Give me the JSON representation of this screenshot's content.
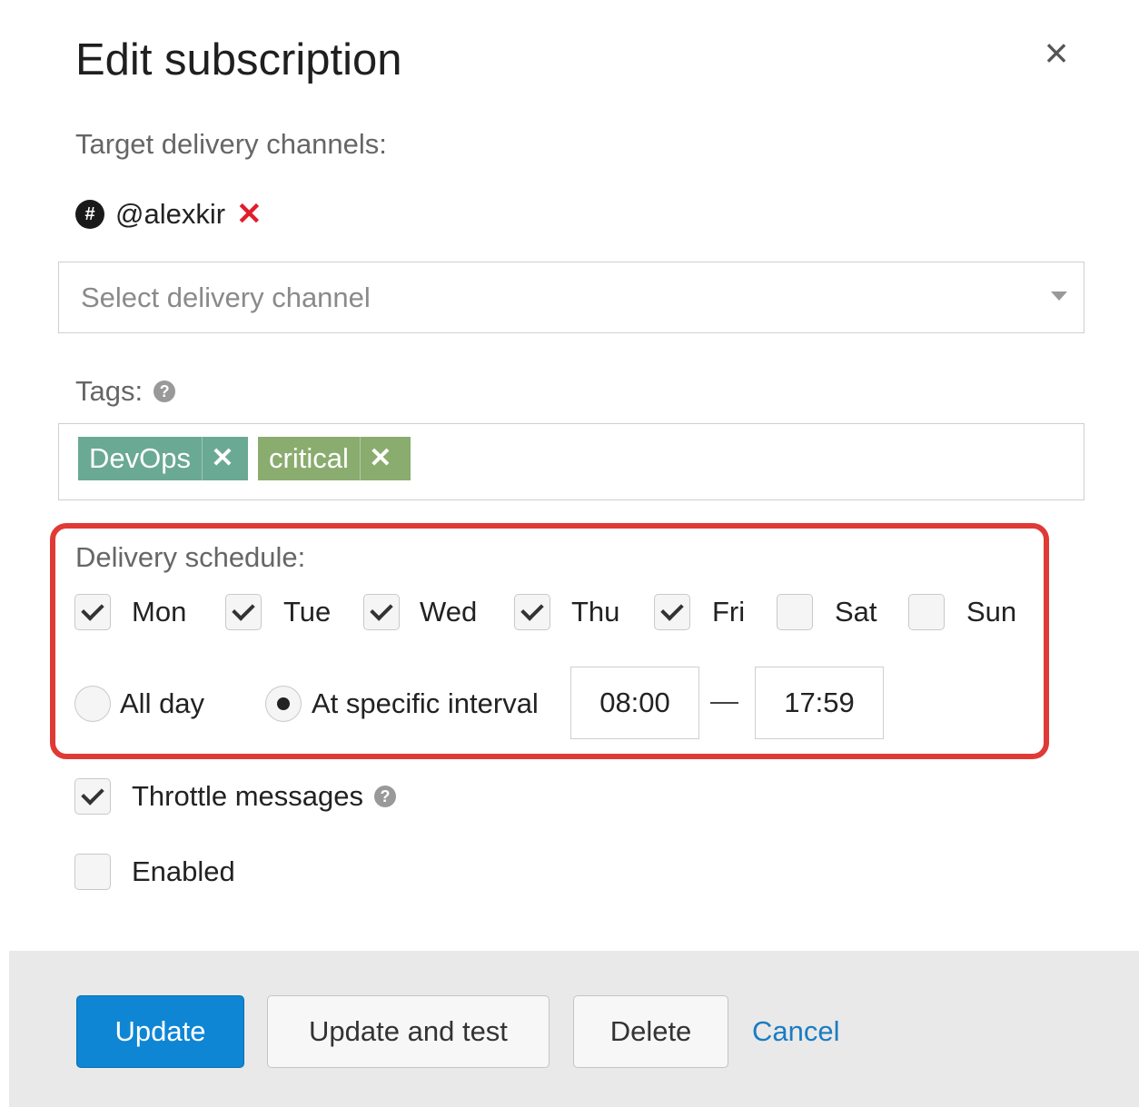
{
  "dialog": {
    "title": "Edit subscription",
    "close_icon": "close-icon"
  },
  "delivery": {
    "label": "Target delivery channels:",
    "channels": [
      {
        "name": "@alexkir",
        "icon": "slack-icon"
      }
    ],
    "select_placeholder": "Select delivery channel"
  },
  "tags": {
    "label": "Tags:",
    "items": [
      {
        "label": "DevOps",
        "color": "#6aa994"
      },
      {
        "label": "critical",
        "color": "#8aac6f"
      }
    ]
  },
  "schedule": {
    "label": "Delivery schedule:",
    "days": [
      {
        "label": "Mon",
        "checked": true
      },
      {
        "label": "Tue",
        "checked": true
      },
      {
        "label": "Wed",
        "checked": true
      },
      {
        "label": "Thu",
        "checked": true
      },
      {
        "label": "Fri",
        "checked": true
      },
      {
        "label": "Sat",
        "checked": false
      },
      {
        "label": "Sun",
        "checked": false
      }
    ],
    "modes": [
      {
        "label": "All day",
        "selected": false
      },
      {
        "label": "At specific interval",
        "selected": true
      }
    ],
    "interval_start": "08:00",
    "interval_separator": "—",
    "interval_end": "17:59",
    "highlight_color": "#e03a36"
  },
  "options": {
    "throttle": {
      "label": "Throttle messages",
      "checked": true
    },
    "enabled": {
      "label": "Enabled",
      "checked": false
    }
  },
  "footer": {
    "update_label": "Update",
    "update_and_test_label": "Update and test",
    "delete_label": "Delete",
    "cancel_label": "Cancel",
    "primary_color": "#0e86d4"
  }
}
